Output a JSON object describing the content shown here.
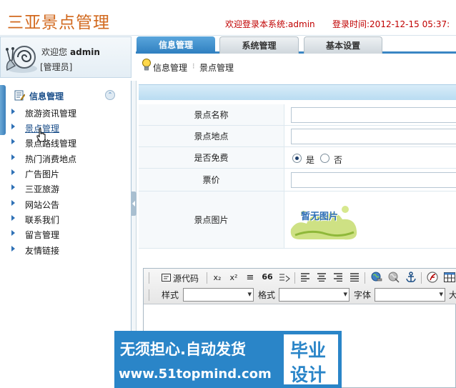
{
  "header": {
    "title": "三亚景点管理",
    "welcome": "欢迎登录本系统:admin",
    "login_time": "登录时间:2012-12-15 05:37:"
  },
  "user": {
    "greeting": "欢迎您",
    "name": "admin",
    "role": "[管理员]"
  },
  "tabs": [
    {
      "label": "信息管理",
      "active": true
    },
    {
      "label": "系统管理",
      "active": false
    },
    {
      "label": "基本设置",
      "active": false
    }
  ],
  "breadcrumb": {
    "first": "信息管理",
    "second": "景点管理"
  },
  "sidebar": {
    "title": "信息管理",
    "collapse_glyph": "⌃",
    "items": [
      {
        "label": "旅游资讯管理"
      },
      {
        "label": "景点管理",
        "selected": true
      },
      {
        "label": "景点路线管理"
      },
      {
        "label": "热门消费地点"
      },
      {
        "label": "广告图片"
      },
      {
        "label": "三亚旅游"
      },
      {
        "label": "网站公告"
      },
      {
        "label": "联系我们"
      },
      {
        "label": "留言管理"
      },
      {
        "label": "友情链接"
      }
    ]
  },
  "form": {
    "name_label": "景点名称",
    "name_value": "",
    "location_label": "景点地点",
    "location_value": "",
    "free_label": "是否免费",
    "free_yes": "是",
    "free_no": "否",
    "free_selected": "是",
    "price_label": "票价",
    "price_value": "",
    "image_label": "景点图片",
    "image_placeholder": "暂无图片"
  },
  "editor": {
    "source": "源代码",
    "subscript": "x₂",
    "superscript": "x²",
    "list_glyph": "≡",
    "quote_glyph": "66",
    "style_label": "样式",
    "format_label": "格式",
    "font_label": "字体",
    "size_label": "大"
  },
  "watermark": {
    "line1": "无须担心.自动发货",
    "line2": "www.51topmind.com",
    "box1": "毕业",
    "box2": "设计"
  },
  "colors": {
    "accent": "#2f7fc0",
    "title": "#d2691e",
    "alert": "#c00000"
  }
}
